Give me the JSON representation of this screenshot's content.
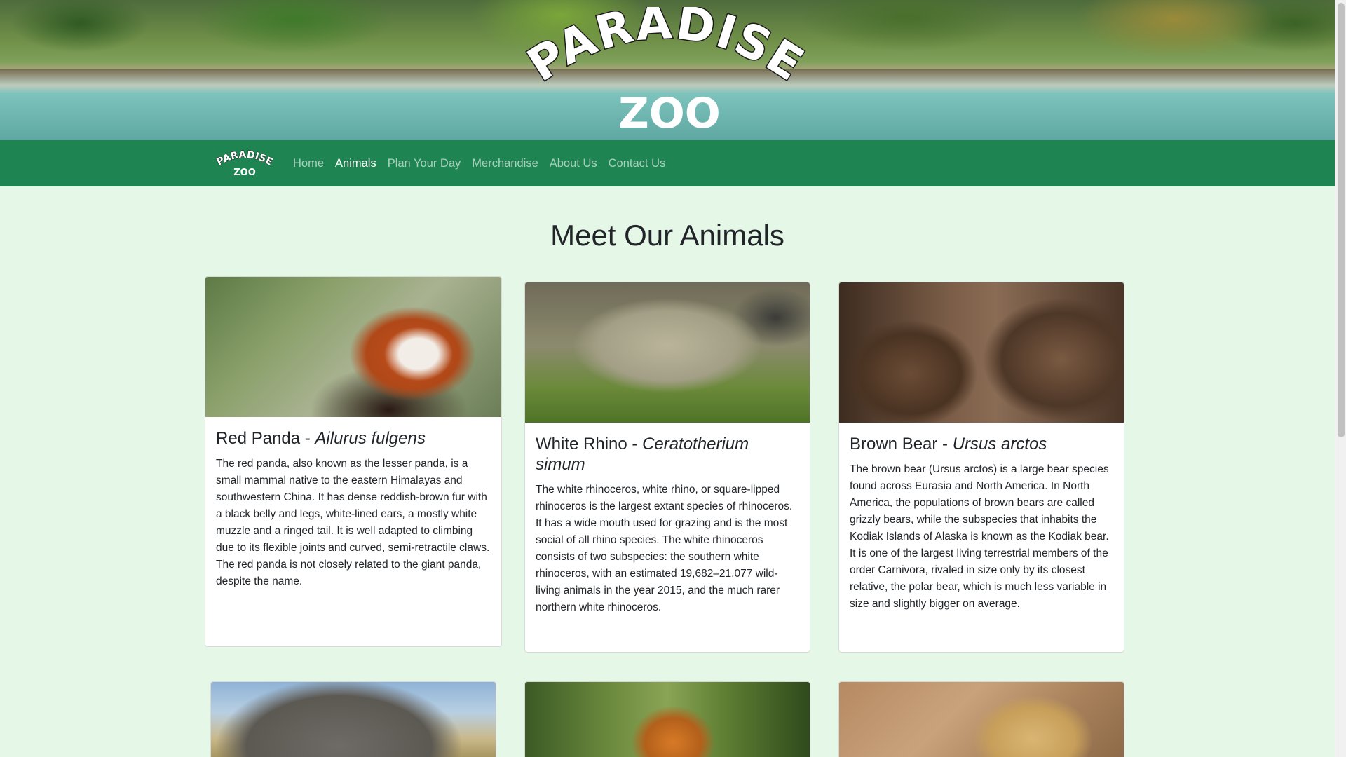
{
  "brand": {
    "logo_line1": "PARADISE",
    "logo_line2": "ZOO"
  },
  "nav": {
    "items": [
      {
        "label": "Home",
        "active": false
      },
      {
        "label": "Animals",
        "active": true
      },
      {
        "label": "Plan Your Day",
        "active": false
      },
      {
        "label": "Merchandise",
        "active": false
      },
      {
        "label": "About Us",
        "active": false
      },
      {
        "label": "Contact Us",
        "active": false
      }
    ]
  },
  "page": {
    "title": "Meet Our Animals"
  },
  "animals": [
    {
      "name": "Red Panda",
      "separator": " - ",
      "scientific": "Ailurus fulgens",
      "description": "The red panda, also known as the lesser panda, is a small mammal native to the eastern Himalayas and southwestern China. It has dense reddish-brown fur with a black belly and legs, white-lined ears, a mostly white muzzle and a ringed tail. It is well adapted to climbing due to its flexible joints and curved, semi-retractile claws. The red panda is not closely related to the giant panda, despite the name."
    },
    {
      "name": "White Rhino",
      "separator": " - ",
      "scientific": "Ceratotherium simum",
      "description": "The white rhinoceros, white rhino, or square-lipped rhinoceros is the largest extant species of rhinoceros. It has a wide mouth used for grazing and is the most social of all rhino species. The white rhinoceros consists of two subspecies: the southern white rhinoceros, with an estimated 19,682–21,077 wild-living animals in the year 2015, and the much rarer northern white rhinoceros."
    },
    {
      "name": "Brown Bear",
      "separator": " - ",
      "scientific": "Ursus arctos",
      "description": "The brown bear (Ursus arctos) is a large bear species found across Eurasia and North America. In North America, the populations of brown bears are called grizzly bears, while the subspecies that inhabits the Kodiak Islands of Alaska is known as the Kodiak bear. It is one of the largest living terrestrial members of the order Carnivora, rivaled in size only by its closest relative, the polar bear, which is much less variable in size and slightly bigger on average."
    }
  ],
  "colors": {
    "navbar": "#1e8552",
    "page_background": "#e5f7e6",
    "nav_link_inactive": "rgba(255,255,255,0.62)",
    "nav_link_active": "#ffffff"
  }
}
